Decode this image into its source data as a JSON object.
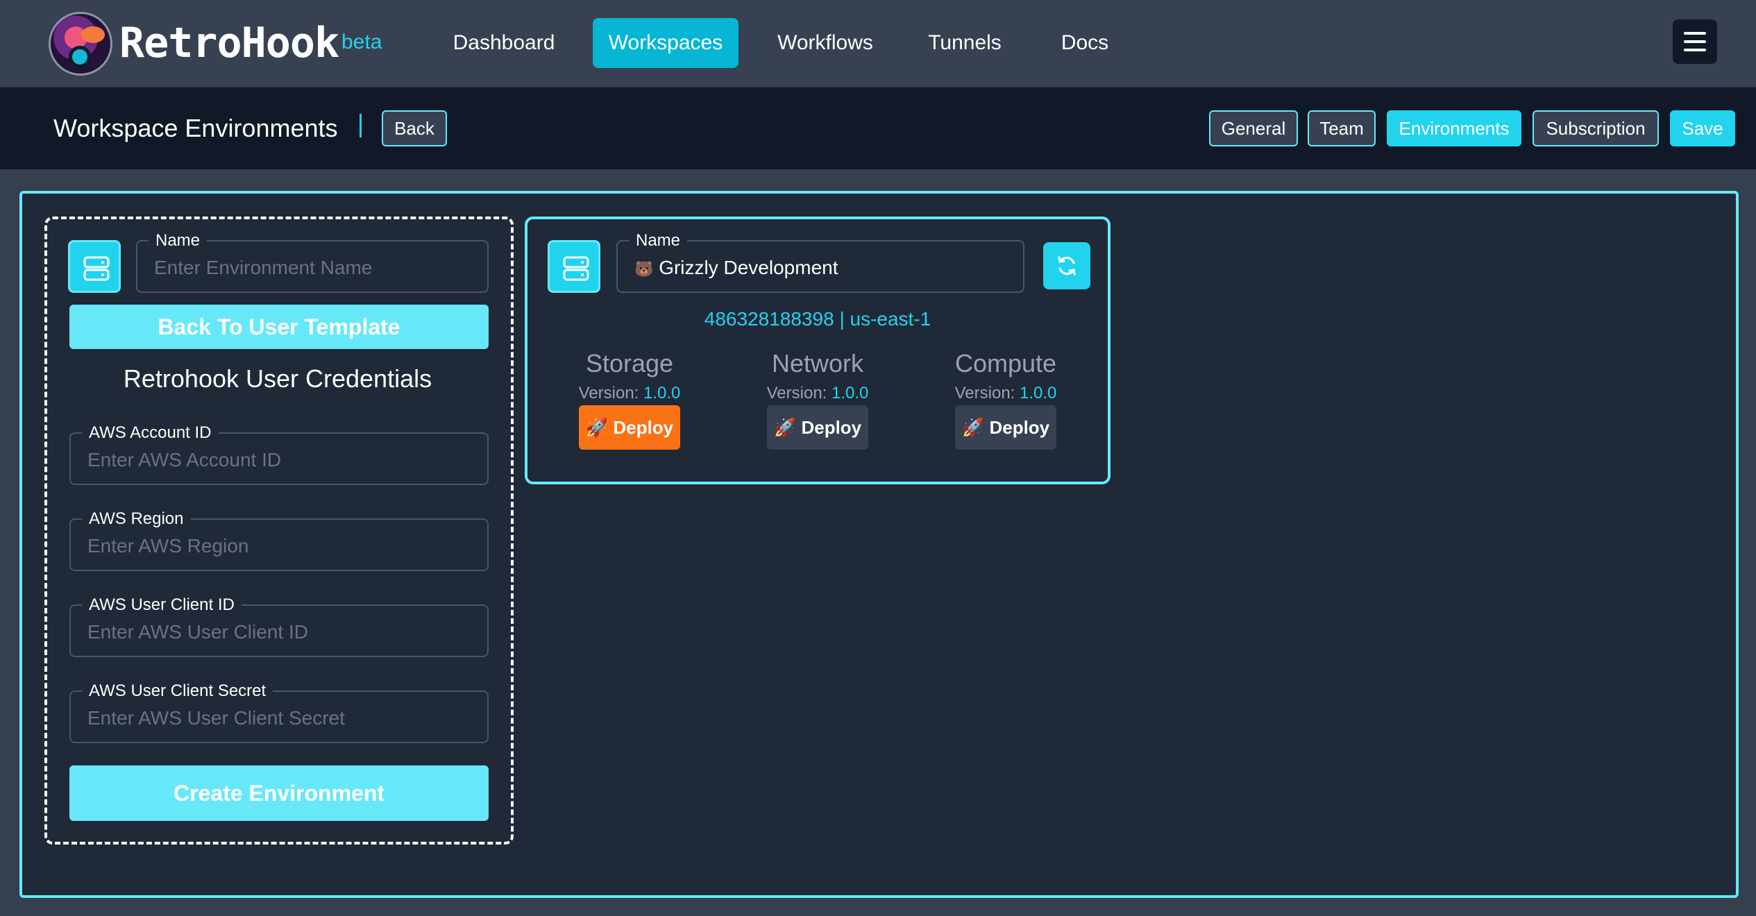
{
  "app": {
    "brand": "RetroHook",
    "badge": "beta"
  },
  "nav": {
    "items": [
      {
        "label": "Dashboard",
        "active": false
      },
      {
        "label": "Workspaces",
        "active": true
      },
      {
        "label": "Workflows",
        "active": false
      },
      {
        "label": "Tunnels",
        "active": false
      },
      {
        "label": "Docs",
        "active": false
      }
    ],
    "menu_icon": "hamburger-icon"
  },
  "subheader": {
    "title": "Workspace Environments",
    "back_label": "Back",
    "tabs": [
      {
        "label": "General",
        "active": false
      },
      {
        "label": "Team",
        "active": false
      },
      {
        "label": "Environments",
        "active": true
      },
      {
        "label": "Subscription",
        "active": false
      }
    ],
    "save_label": "Save"
  },
  "create_form": {
    "icon": "server-icon",
    "name_label": "Name",
    "name_placeholder": "Enter Environment Name",
    "back_template_label": "Back To User Template",
    "credentials_title": "Retrohook User Credentials",
    "fields": [
      {
        "label": "AWS Account ID",
        "placeholder": "Enter AWS Account ID"
      },
      {
        "label": "AWS Region",
        "placeholder": "Enter AWS Region"
      },
      {
        "label": "AWS User Client ID",
        "placeholder": "Enter AWS User Client ID"
      },
      {
        "label": "AWS User Client Secret",
        "placeholder": "Enter AWS User Client Secret"
      }
    ],
    "create_label": "Create Environment"
  },
  "environment": {
    "icon": "server-icon",
    "name_label": "Name",
    "name_emoji": "🐻",
    "name_value": "Grizzly Development",
    "refresh_icon": "refresh-icon",
    "account_id": "486328188398",
    "separator": "|",
    "region": "us-east-1",
    "services": [
      {
        "name": "Storage",
        "version_label": "Version:",
        "version": "1.0.0",
        "deploy_label": "Deploy",
        "deploy_icon": "rocket-icon",
        "state": "highlighted"
      },
      {
        "name": "Network",
        "version_label": "Version:",
        "version": "1.0.0",
        "deploy_label": "Deploy",
        "deploy_icon": "rocket-icon",
        "state": "default"
      },
      {
        "name": "Compute",
        "version_label": "Version:",
        "version": "1.0.0",
        "deploy_label": "Deploy",
        "deploy_icon": "rocket-icon",
        "state": "default"
      }
    ]
  },
  "colors": {
    "accent": "#22d3ee",
    "accent_light": "#67e8f9",
    "deploy_highlight": "#f97316",
    "nav_bg": "#374151",
    "subheader_bg": "#111827",
    "panel_bg": "#1f2937"
  }
}
